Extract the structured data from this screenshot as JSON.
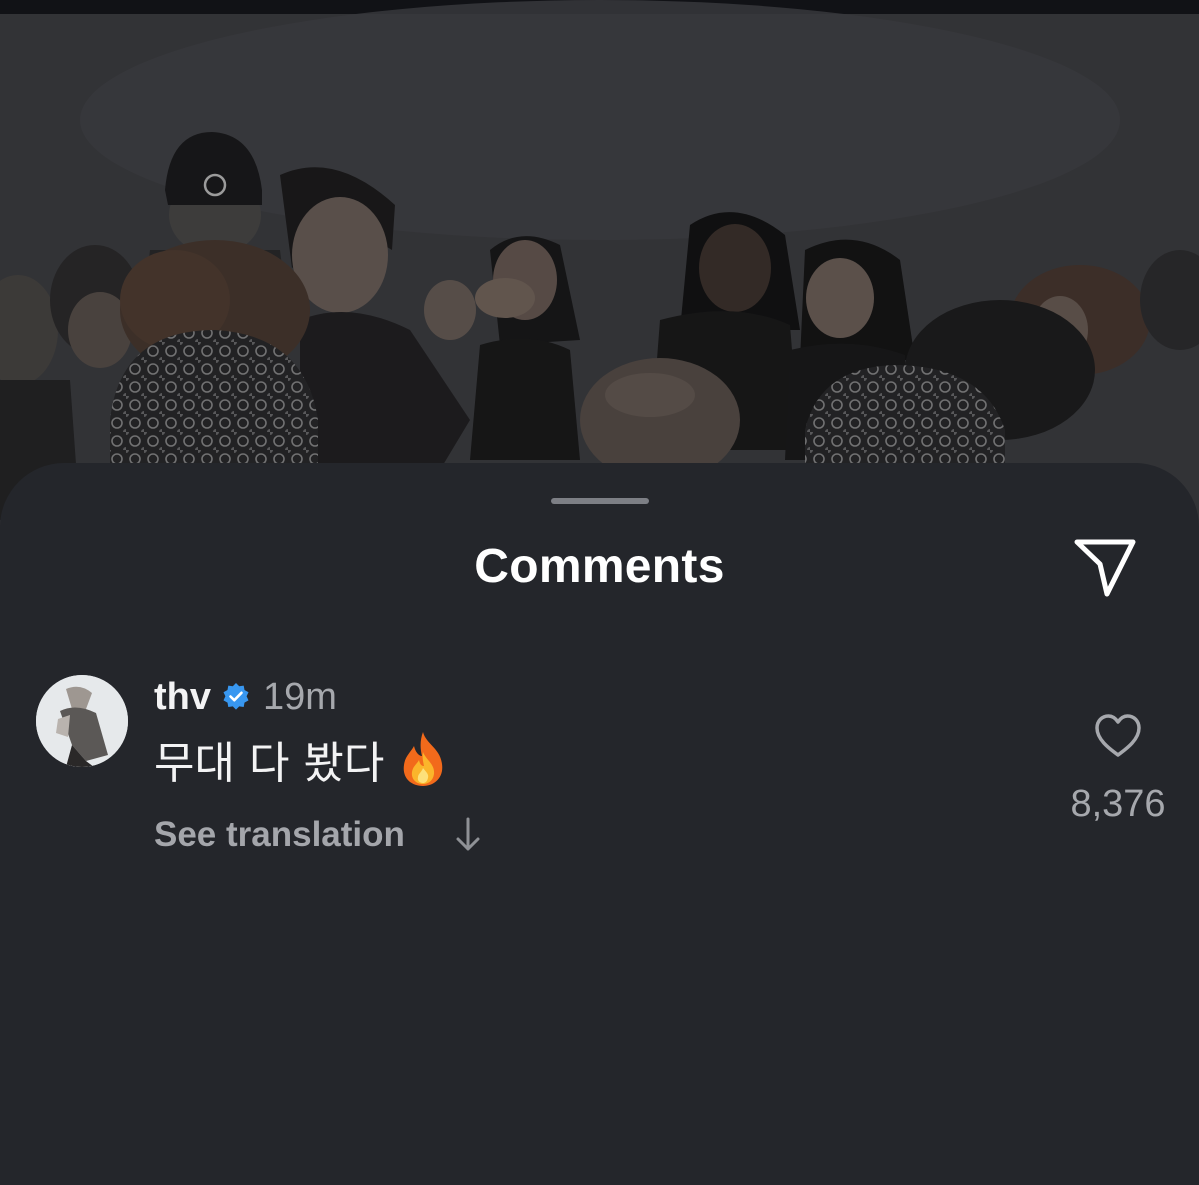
{
  "sheet": {
    "title": "Comments",
    "share_icon": "send-icon"
  },
  "comment": {
    "avatar_icon": "user-avatar",
    "username": "thv",
    "verified_icon": "verified-badge-icon",
    "time": "19m",
    "text": "무대 다 봤다",
    "emoji_icon": "fire-icon",
    "see_translation": "See translation",
    "translation_arrow_icon": "arrow-down-icon",
    "like_icon": "heart-icon",
    "like_count": "8,376"
  },
  "colors": {
    "sheet_bg": "#24262b",
    "verified_blue": "#3897f0",
    "text_primary": "#f3f3f4",
    "text_secondary": "#a6a8ad"
  }
}
